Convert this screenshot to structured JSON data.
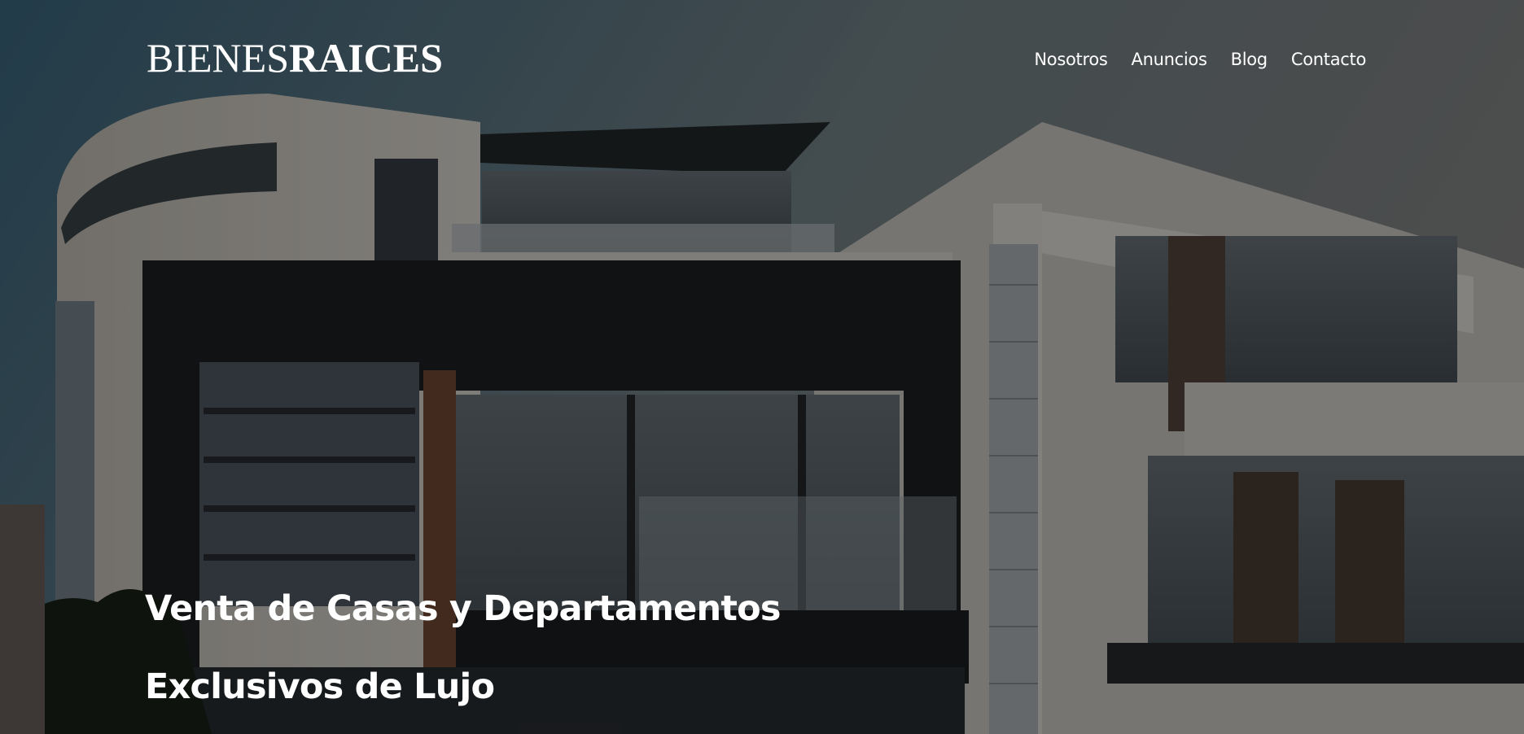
{
  "header": {
    "logo": {
      "light": "BIENES",
      "bold": "RAICES"
    },
    "nav": [
      {
        "label": "Nosotros"
      },
      {
        "label": "Anuncios"
      },
      {
        "label": "Blog"
      },
      {
        "label": "Contacto"
      }
    ]
  },
  "hero": {
    "headline_line1": "Venta de Casas y Departamentos",
    "headline_line2": "Exclusivos de Lujo"
  },
  "colors": {
    "text": "#ffffff",
    "overlay": "rgba(0,0,0,0.45)"
  }
}
